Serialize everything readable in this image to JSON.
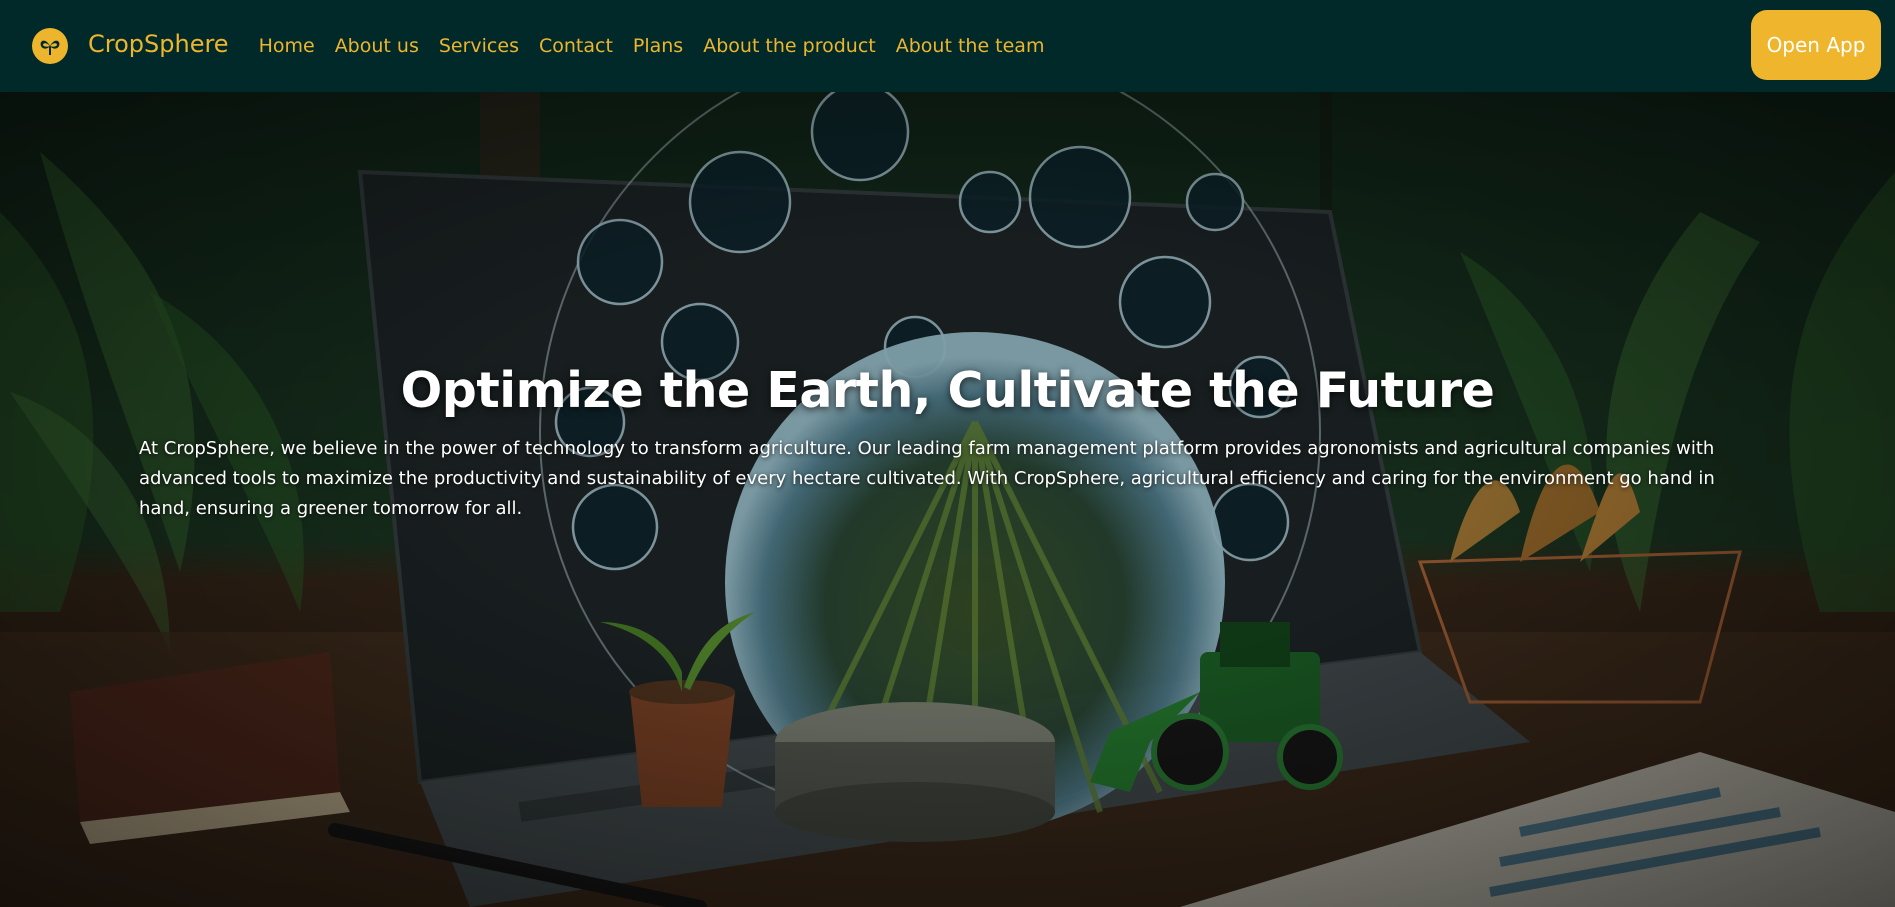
{
  "nav": {
    "brand": "CropSphere",
    "links": [
      "Home",
      "About us",
      "Services",
      "Contact",
      "Plans",
      "About the product",
      "About the team"
    ],
    "cta": "Open App"
  },
  "hero": {
    "title": "Optimize the Earth, Cultivate the Future",
    "text": "At CropSphere, we believe in the power of technology to transform agriculture. Our leading farm management platform provides agronomists and agricultural companies with advanced tools to maximize the productivity and sustainability of every hectare cultivated. With CropSphere, agricultural efficiency and caring for the environment go hand in hand, ensuring a greener tomorrow for all.",
    "image": "farm-technology-hero-image"
  },
  "colors": {
    "navbar": "#01292a",
    "accent": "#ecb52d",
    "button": "#efb62d",
    "text": "#ffffff"
  },
  "icons": [
    "sprout-logo-icon"
  ]
}
